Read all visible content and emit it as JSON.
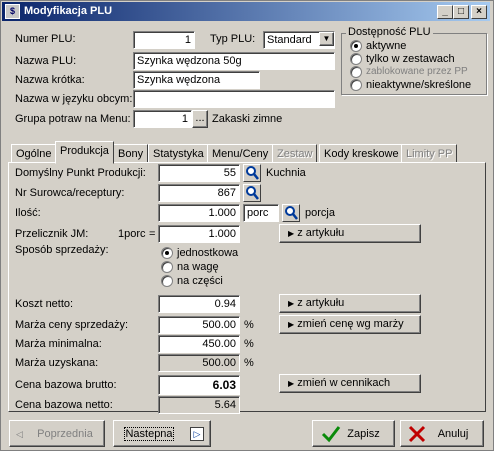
{
  "window": {
    "title": "Modyfikacja PLU"
  },
  "header": {
    "numer_plu_label": "Numer PLU:",
    "numer_plu_value": "1",
    "typ_plu_label": "Typ PLU:",
    "typ_plu_value": "Standard",
    "nazwa_plu_label": "Nazwa PLU:",
    "nazwa_plu_value": "Szynka wędzona 50g",
    "nazwa_krotka_label": "Nazwa krótka:",
    "nazwa_krotka_value": "Szynka wędzona",
    "nazwa_obcy_label": "Nazwa w języku obcym:",
    "nazwa_obcy_value": "",
    "grupa_label": "Grupa potraw na Menu:",
    "grupa_value": "1",
    "grupa_browse": "...",
    "grupa_name": "Zakaski zimne"
  },
  "dostepnosc": {
    "title": "Dostępność PLU",
    "options": [
      {
        "label": "aktywne",
        "selected": true,
        "disabled": false
      },
      {
        "label": "tylko w zestawach",
        "selected": false,
        "disabled": false
      },
      {
        "label": "zablokowane przez PP",
        "selected": false,
        "disabled": true
      },
      {
        "label": "nieaktywne/skreślone",
        "selected": false,
        "disabled": false
      }
    ]
  },
  "tabs": [
    {
      "label": "Ogólne",
      "active": false,
      "disabled": false
    },
    {
      "label": "Produkcja",
      "active": true,
      "disabled": false
    },
    {
      "label": "Bony",
      "active": false,
      "disabled": false
    },
    {
      "label": "Statystyka",
      "active": false,
      "disabled": false
    },
    {
      "label": "Menu/Ceny",
      "active": false,
      "disabled": false
    },
    {
      "label": "Zestaw",
      "active": false,
      "disabled": true
    },
    {
      "label": "Kody kreskowe",
      "active": false,
      "disabled": false
    },
    {
      "label": "Limity PP",
      "active": false,
      "disabled": true
    }
  ],
  "produkcja": {
    "punkt_label": "Domyślny Punkt Produkcji:",
    "punkt_value": "55",
    "punkt_name": "Kuchnia",
    "surowca_label": "Nr Surowca/receptury:",
    "surowca_value": "867",
    "ilosc_label": "Ilość:",
    "ilosc_value": "1.000",
    "ilosc_unit": "porc",
    "ilosc_unit_name": "porcja",
    "przelicznik_label": "Przelicznik JM:",
    "przelicznik_unit": "1porc",
    "przelicznik_eq": "=",
    "przelicznik_value": "1.000",
    "z_artykulu_1": "z artykułu",
    "sposob_label": "Sposób sprzedaży:",
    "sposob_options": [
      {
        "label": "jednostkowa",
        "selected": true
      },
      {
        "label": "na wagę",
        "selected": false
      },
      {
        "label": "na części",
        "selected": false
      }
    ],
    "koszt_label": "Koszt netto:",
    "koszt_value": "0.94",
    "marza_ceny_label": "Marża ceny sprzedaży:",
    "marza_ceny_value": "500.00",
    "marza_ceny_unit": "%",
    "marza_min_label": "Marża minimalna:",
    "marza_min_value": "450.00",
    "marza_min_unit": "%",
    "marza_uzysk_label": "Marża uzyskana:",
    "marza_uzysk_value": "500.00",
    "marza_uzysk_unit": "%",
    "cena_brutto_label": "Cena bazowa brutto:",
    "cena_brutto_value": "6.03",
    "cena_netto_label": "Cena bazowa netto:",
    "cena_netto_value": "5.64",
    "z_artykulu_2": "z artykułu",
    "zmien_cene_marzy": "zmień cenę wg marży",
    "zmien_w_cennikach": "zmień w cennikach"
  },
  "footer": {
    "poprzednia": "Poprzednia",
    "nastepna": "Nastepna",
    "zapisz": "Zapisz",
    "anuluj": "Anuluj"
  }
}
